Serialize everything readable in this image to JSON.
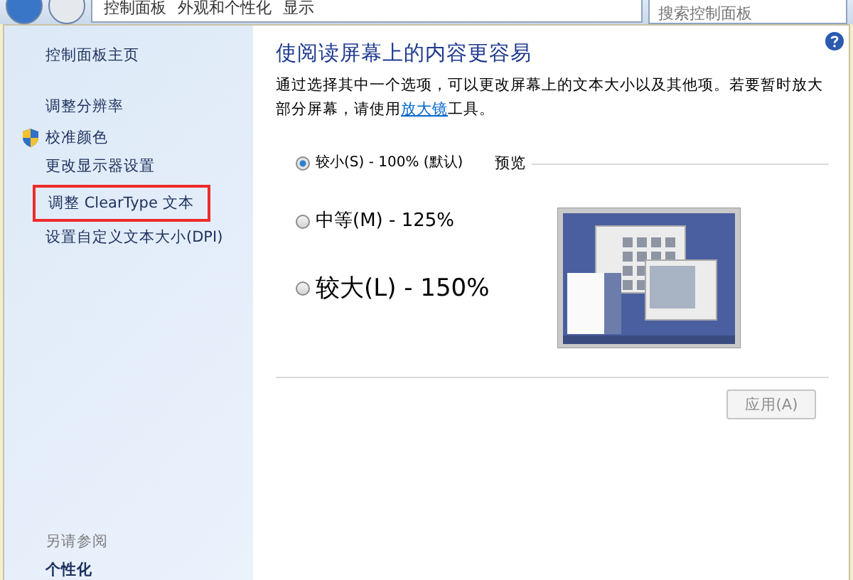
{
  "address_bar": {
    "breadcrumbs": [
      "控制面板",
      "外观和个性化",
      "显示"
    ],
    "search": {
      "placeholder": "搜索控制面板"
    }
  },
  "sidebar": {
    "items": [
      {
        "label": "控制面板主页",
        "kind": "home",
        "highlighted": false
      },
      {
        "label": "调整分辨率",
        "kind": "link",
        "highlighted": false
      },
      {
        "label": "校准颜色",
        "kind": "shield",
        "highlighted": false
      },
      {
        "label": "更改显示器设置",
        "kind": "link",
        "highlighted": false
      },
      {
        "label": "调整 ClearType 文本",
        "kind": "link",
        "highlighted": true
      },
      {
        "label": "设置自定义文本大小(DPI)",
        "kind": "link",
        "highlighted": false
      }
    ],
    "see_also": {
      "heading": "另请参阅",
      "items": [
        "个性化"
      ]
    }
  },
  "main": {
    "title": "使阅读屏幕上的内容更容易",
    "description_before": "通过选择其中一个选项，可以更改屏幕上的文本大小以及其他项。若要暂时放大部分屏幕，请使用",
    "description_link": "放大镜",
    "description_after": "工具。",
    "options": [
      {
        "label": "较小(S) - 100% (默认)",
        "kind": "small",
        "selected": true
      },
      {
        "label": "中等(M) - 125%",
        "kind": "medium",
        "selected": false
      },
      {
        "label": "较大(L) - 150%",
        "kind": "large",
        "selected": false
      }
    ],
    "preview_label": "预览",
    "apply_button": {
      "label": "应用(A)",
      "disabled": true
    }
  }
}
